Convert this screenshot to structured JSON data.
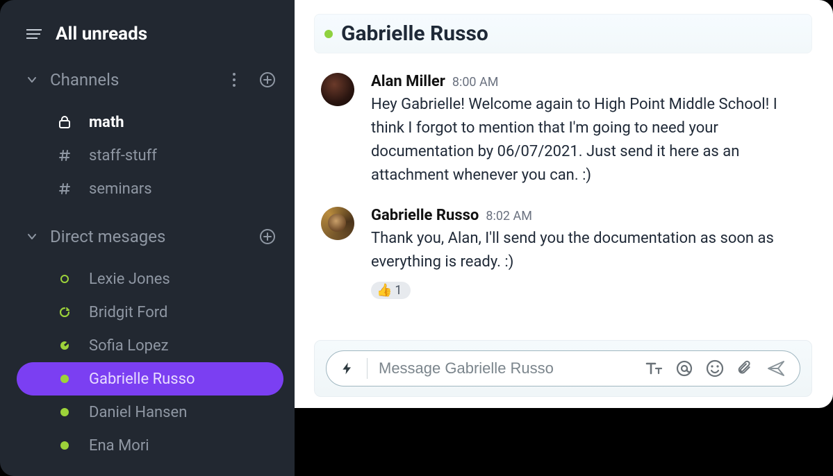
{
  "sidebar": {
    "all_unreads": "All unreads",
    "channels_header": "Channels",
    "dm_header": "Direct mesages",
    "channels": [
      {
        "name": "math",
        "icon": "lock",
        "active": true
      },
      {
        "name": "staff-stuff",
        "icon": "hash",
        "active": false
      },
      {
        "name": "seminars",
        "icon": "hash",
        "active": false
      }
    ],
    "dms": [
      {
        "name": "Lexie Jones",
        "presence": "ring",
        "selected": false
      },
      {
        "name": "Bridgit Ford",
        "presence": "away",
        "selected": false
      },
      {
        "name": "Sofia Lopez",
        "presence": "dnd",
        "selected": false
      },
      {
        "name": "Gabrielle Russo",
        "presence": "online",
        "selected": true
      },
      {
        "name": "Daniel Hansen",
        "presence": "online",
        "selected": false
      },
      {
        "name": "Ena Mori",
        "presence": "online",
        "selected": false
      }
    ]
  },
  "chat": {
    "title": "Gabrielle Russo",
    "messages": [
      {
        "author": "Alan Miller",
        "time": "8:00 AM",
        "avatar": "alan",
        "text": "Hey Gabrielle! Welcome again to High Point Middle School! I think I forgot to mention that I'm going to need your documentation by 06/07/2021. Just send it here as an attachment whenever you can. :)",
        "reactions": []
      },
      {
        "author": "Gabrielle Russo",
        "time": "8:02 AM",
        "avatar": "gabi",
        "text": "Thank you, Alan, I'll send you the documentation as soon as everything is ready. :)",
        "reactions": [
          {
            "emoji": "👍",
            "count": "1"
          }
        ]
      }
    ],
    "composer_placeholder": "Message Gabrielle Russo"
  }
}
